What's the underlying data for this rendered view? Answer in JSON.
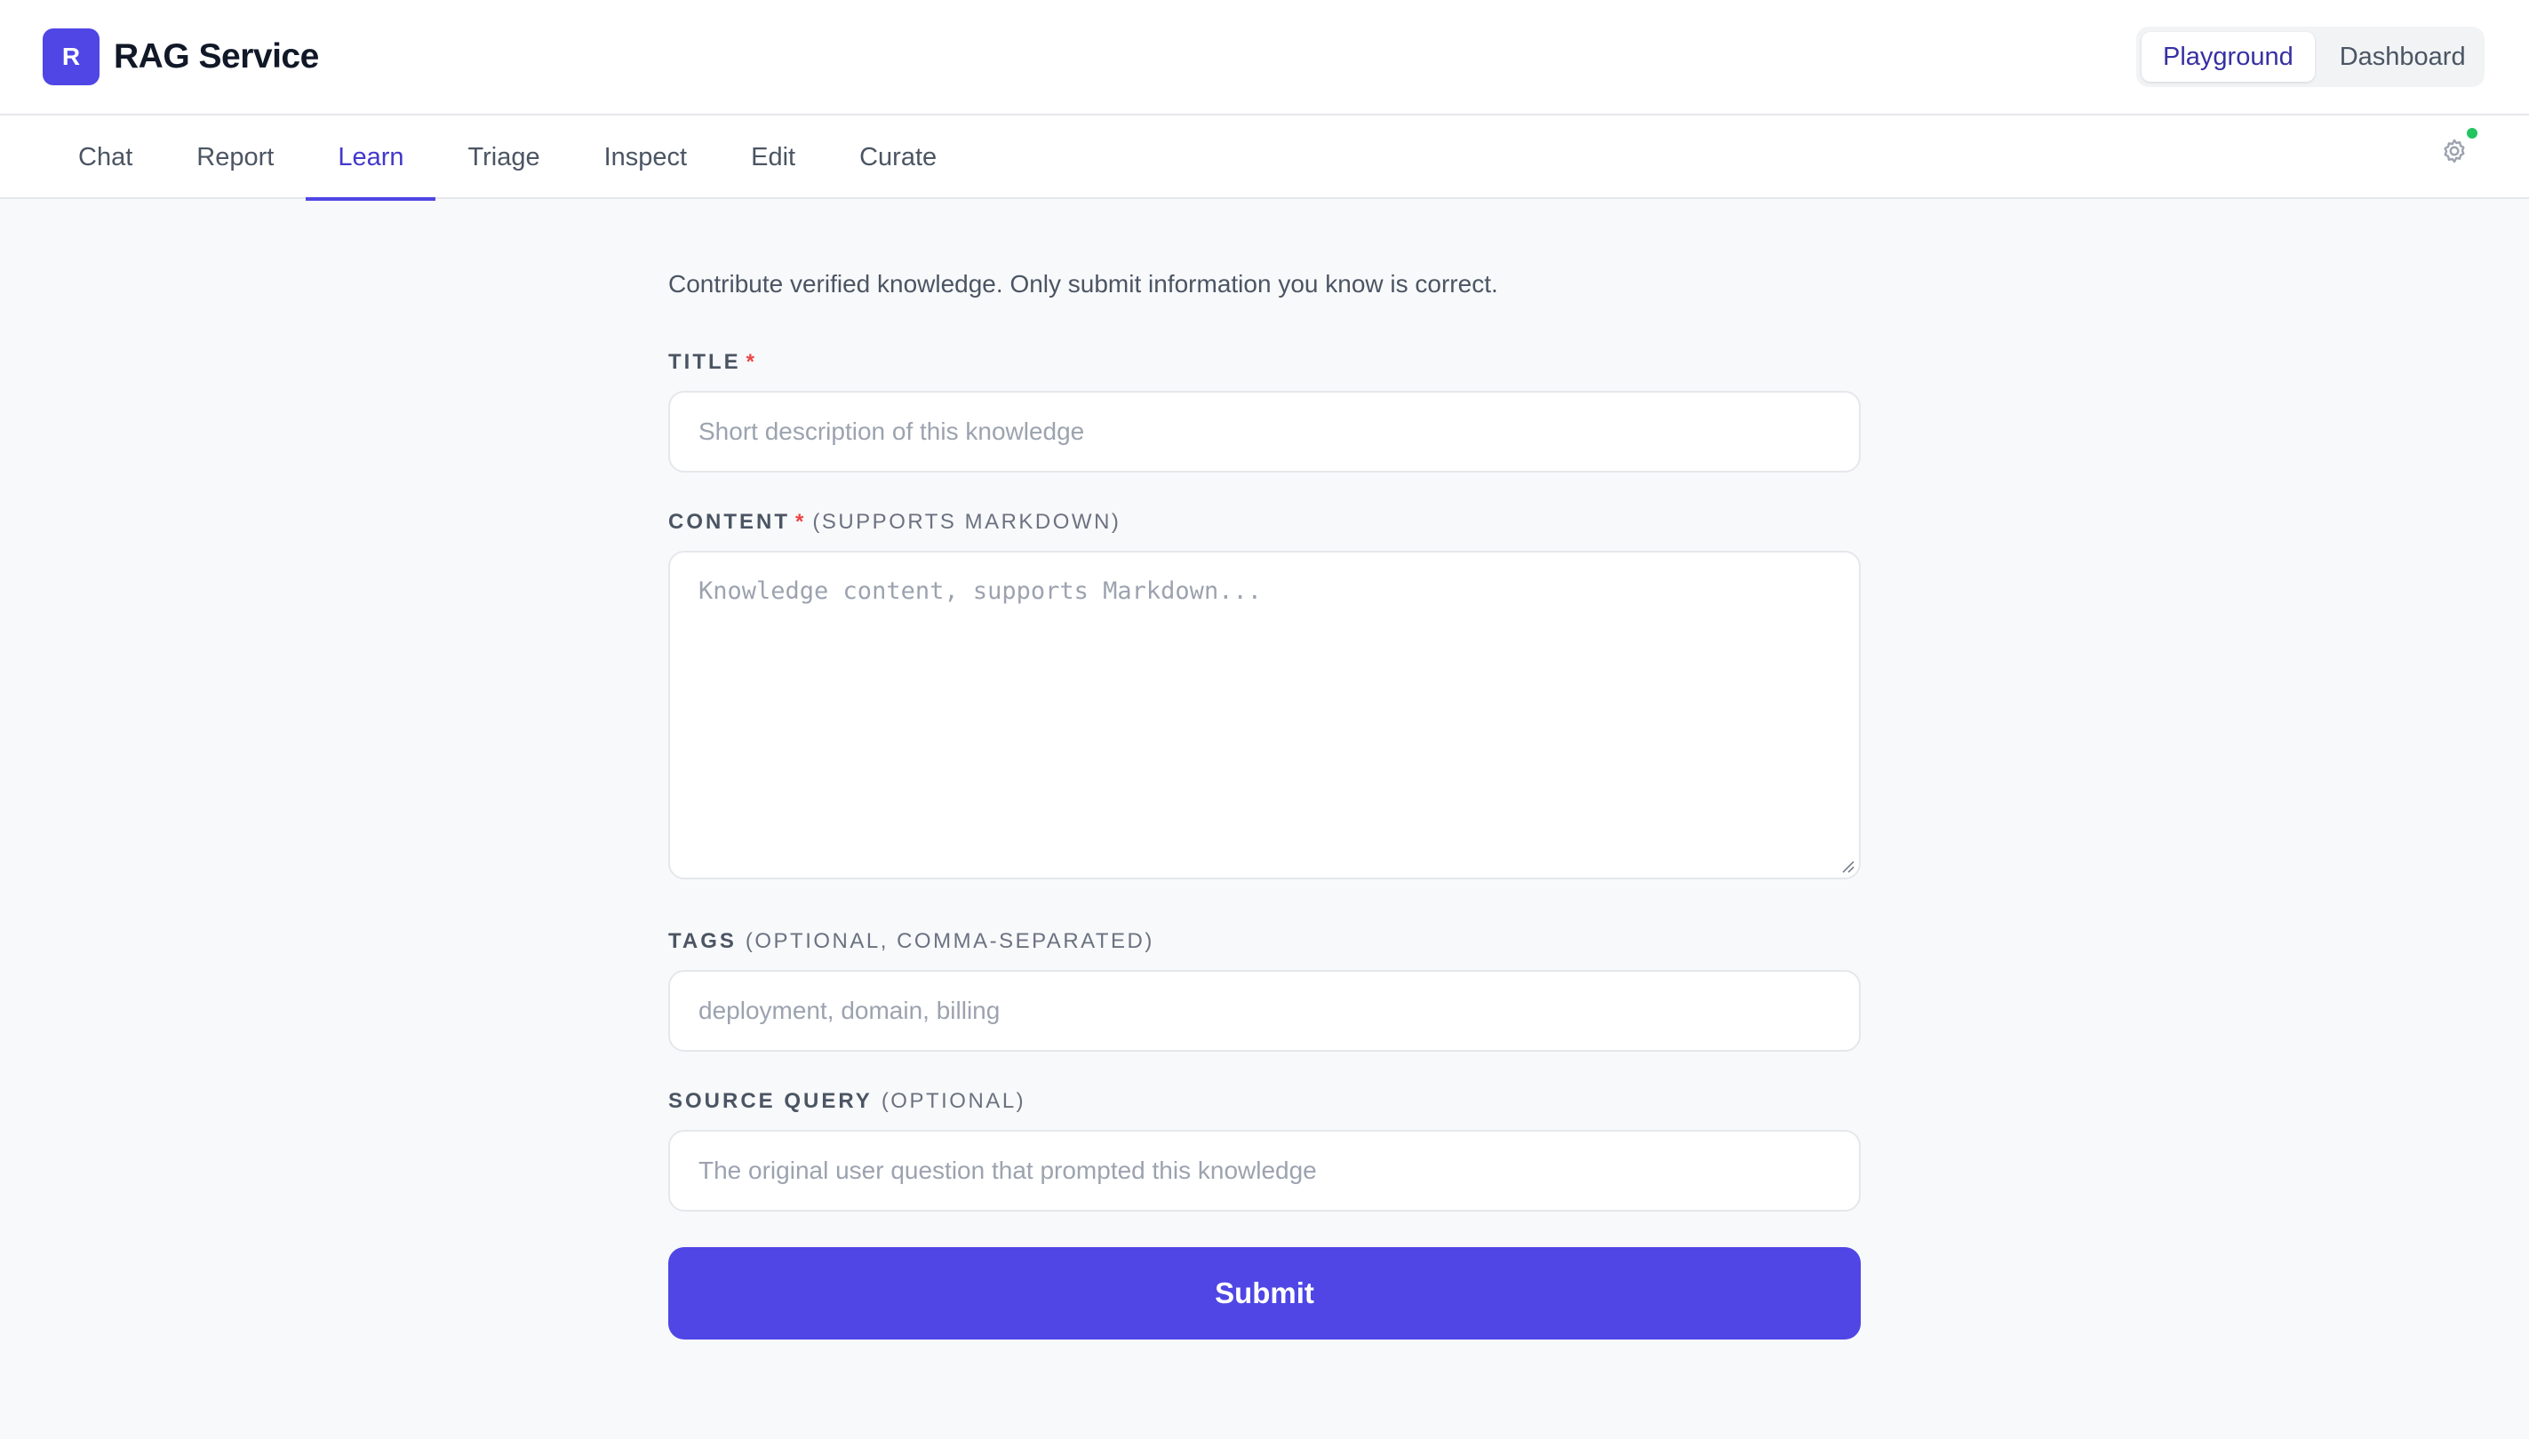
{
  "app": {
    "logo_letter": "R",
    "title": "RAG Service"
  },
  "mode_toggle": {
    "options": [
      "Playground",
      "Dashboard"
    ],
    "active": "Playground"
  },
  "tabs": [
    {
      "label": "Chat"
    },
    {
      "label": "Report"
    },
    {
      "label": "Learn"
    },
    {
      "label": "Triage"
    },
    {
      "label": "Inspect"
    },
    {
      "label": "Edit"
    },
    {
      "label": "Curate"
    }
  ],
  "active_tab": "Learn",
  "status": {
    "color": "#22c55e"
  },
  "form": {
    "intro": "Contribute verified knowledge. Only submit information you know is correct.",
    "title": {
      "label": "TITLE",
      "required_mark": "*",
      "placeholder": "Short description of this knowledge"
    },
    "content": {
      "label": "CONTENT",
      "required_mark": "*",
      "hint": "(SUPPORTS MARKDOWN)",
      "placeholder": "Knowledge content, supports Markdown..."
    },
    "tags": {
      "label": "TAGS",
      "hint": "(OPTIONAL, COMMA-SEPARATED)",
      "placeholder": "deployment, domain, billing"
    },
    "source_query": {
      "label": "SOURCE QUERY",
      "hint": "(OPTIONAL)",
      "placeholder": "The original user question that prompted this knowledge"
    },
    "submit_label": "Submit"
  },
  "colors": {
    "accent": "#4f46e5",
    "required": "#ef4444"
  }
}
